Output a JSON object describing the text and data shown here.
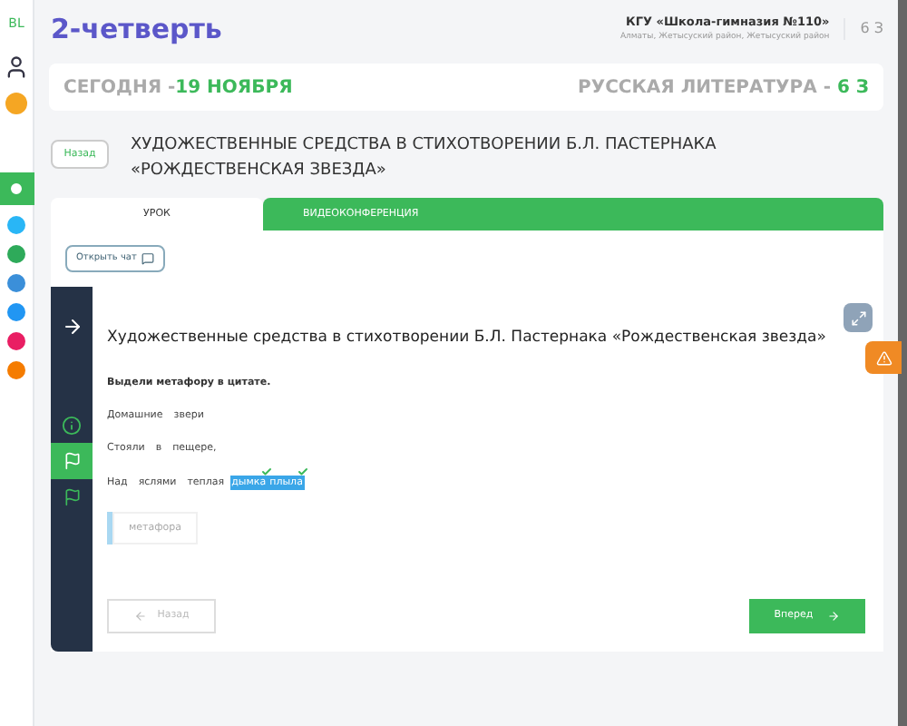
{
  "rail": {
    "logo": "BL",
    "items": [
      {
        "kind": "avatar"
      },
      {
        "kind": "badge",
        "color": "#f5a623"
      },
      {
        "kind": "active",
        "selected": true
      },
      {
        "kind": "dot",
        "color": "#29b6f6"
      },
      {
        "kind": "dot",
        "color": "#2eaa5a"
      },
      {
        "kind": "dot",
        "color": "#3b8fd9"
      },
      {
        "kind": "dot",
        "color": "#2196f3"
      },
      {
        "kind": "dot",
        "color": "#e91e63"
      },
      {
        "kind": "dot",
        "color": "#f57c00"
      }
    ]
  },
  "header": {
    "title": "2-четверть",
    "school": "КГУ «Школа-гимназия №110»",
    "address": "Алматы, Жетысуский район, Жетысуский район",
    "class": "6 З"
  },
  "today": {
    "label": "СЕГОДНЯ -",
    "date": "19 НОЯБРЯ",
    "subject": "РУССКАЯ ЛИТЕРАТУРА - ",
    "class": "6 З"
  },
  "lesson": {
    "back": "Назад",
    "title": "ХУДОЖЕСТВЕННЫЕ СРЕДСТВА В СТИХОТВОРЕНИИ Б.Л. ПАСТЕРНАКА «РОЖДЕСТВЕНСКАЯ ЗВЕЗДА»"
  },
  "tabs": [
    {
      "label": "УРОК",
      "selected": true
    },
    {
      "label": "ВИДЕОКОНФЕРЕНЦИЯ",
      "selected": false
    }
  ],
  "chat_button": "Открыть чат",
  "strip": [
    {
      "kind": "arrow",
      "selected": false
    },
    {
      "kind": "info",
      "selected": false
    },
    {
      "kind": "flag",
      "selected": true
    },
    {
      "kind": "flag",
      "selected": false
    }
  ],
  "task": {
    "heading": "Художественные средства в стихотворении Б.Л. Пастернака «Рождественская звезда»",
    "instruction": "Выдели метафору в цитате.",
    "lines": [
      [
        {
          "text": "Домашние",
          "selected": false
        },
        {
          "text": "звери",
          "selected": false
        }
      ],
      [
        {
          "text": "Стояли",
          "selected": false
        },
        {
          "text": "в",
          "selected": false
        },
        {
          "text": "пещере,",
          "selected": false
        }
      ],
      [
        {
          "text": "Над",
          "selected": false
        },
        {
          "text": "яслями",
          "selected": false
        },
        {
          "text": "теплая",
          "selected": false
        },
        {
          "text": "дымка",
          "selected": true
        },
        {
          "text": "плыла",
          "selected": true
        }
      ]
    ],
    "answer": "метафора"
  },
  "nav": {
    "prev": "Назад",
    "prev_disabled": true,
    "next": "Вперед"
  }
}
